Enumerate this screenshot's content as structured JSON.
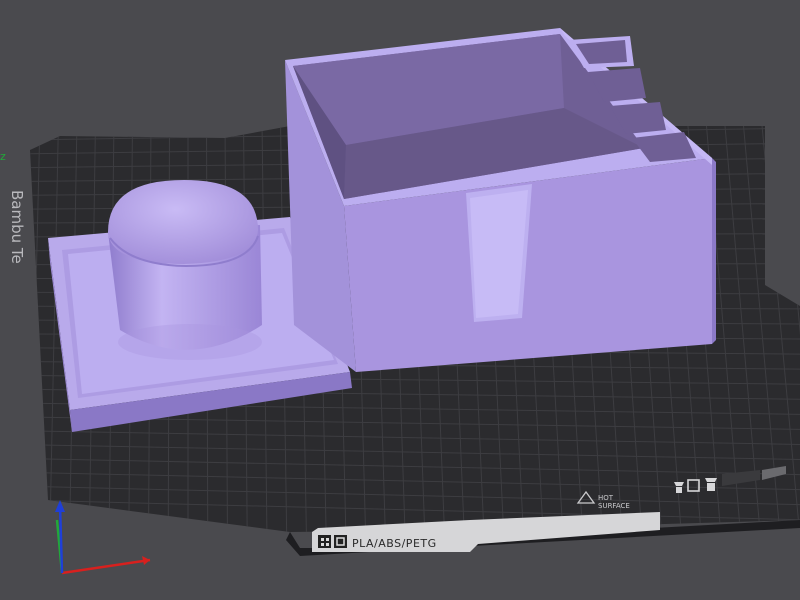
{
  "bed": {
    "brand_text": "Bambu Te",
    "filament_label": "PLA/ABS/PETG",
    "surface_label_line1": "HOT",
    "surface_label_line2": "SURFACE"
  },
  "axes": {
    "x_color": "#d8201e",
    "y_color": "#22a83a",
    "z_color": "#1f3fd8",
    "offscreen_axis_label": "z"
  },
  "colors": {
    "background": "#4a4a4e",
    "plate": "#2b2b2e",
    "grid_line": "#3d3d41",
    "model_light": "#bfb0ee",
    "model_mid": "#a995df",
    "model_dark": "#6a5a8f"
  },
  "icons": [
    "plate-logo-icon",
    "printer-symbol-icon",
    "fan-icon"
  ]
}
